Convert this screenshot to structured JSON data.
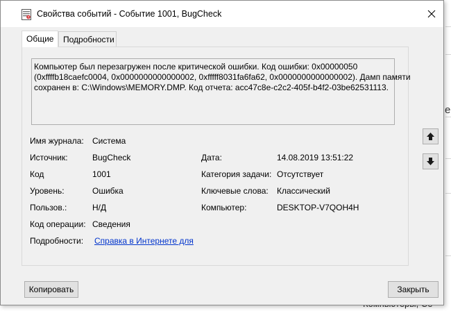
{
  "window": {
    "title": "Свойства событий - Событие 1001, BugCheck"
  },
  "tabs": [
    {
      "label": "Общие",
      "active": true
    },
    {
      "label": "Подробности",
      "active": false
    }
  ],
  "description": {
    "lines": [
      "Компьютер был перезагружен после критической ошибки.  Код ошибки: 0x00000050",
      "(0xffffb18caefc0004, 0x0000000000000002, 0xfffff8031fa6fa62, 0x0000000000000002). Дамп памяти",
      "сохранен в: C:\\Windows\\MEMORY.DMP. Код отчета: acc47c8e-c2c2-405f-b4f2-03be62531113."
    ]
  },
  "fields": {
    "log_name": {
      "label": "Имя журнала:",
      "value": "Система"
    },
    "source": {
      "label": "Источник:",
      "value": "BugCheck"
    },
    "date": {
      "label": "Дата:",
      "value": "14.08.2019 13:51:22"
    },
    "event_id": {
      "label": "Код",
      "value": "1001"
    },
    "task_category": {
      "label": "Категория задачи:",
      "value": "Отсутствует"
    },
    "level": {
      "label": "Уровень:",
      "value": "Ошибка"
    },
    "keywords": {
      "label": "Ключевые слова:",
      "value": "Классический"
    },
    "user": {
      "label": "Пользов.:",
      "value": "Н/Д"
    },
    "computer": {
      "label": "Компьютер:",
      "value": "DESKTOP-V7QOH4H"
    },
    "opcode": {
      "label": "Код операции:",
      "value": "Сведения"
    },
    "more_info": {
      "label": "Подробности:",
      "link": "Справка в Интернете для"
    }
  },
  "buttons": {
    "copy": "Копировать",
    "close": "Закрыть"
  },
  "background": {
    "bottom_text": "Компьютеры, Се",
    "side_char": "е"
  },
  "colors": {
    "link": "#0033cc",
    "window_bg": "#f0f0f0",
    "titlebar_bg": "#ffffff",
    "button_bg": "#e1e1e1"
  }
}
